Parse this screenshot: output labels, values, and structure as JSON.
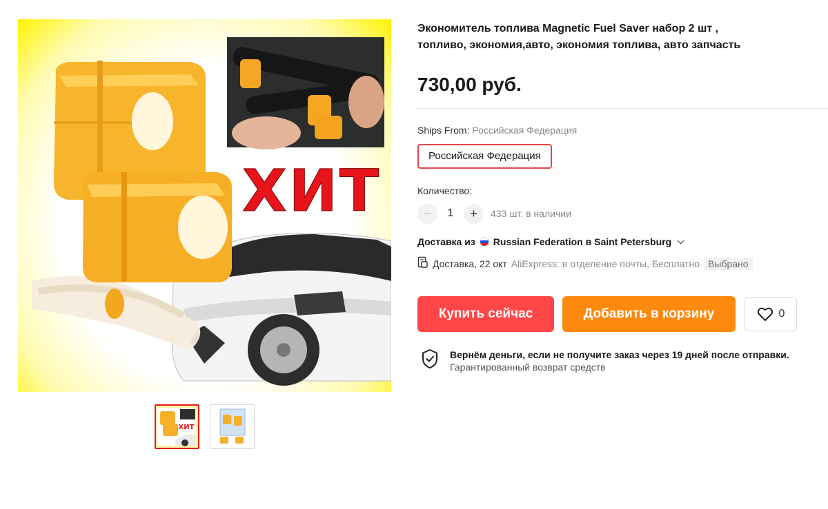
{
  "product": {
    "title": "Экономитель топлива Magnetic Fuel Saver набор 2 шт , топливо, экономия,авто, экономия топлива, авто запчасть",
    "price": "730,00 руб.",
    "image_badge_text": "ХИТ"
  },
  "gallery": {
    "thumbnails": [
      "thumb-1",
      "thumb-2"
    ],
    "selected_index": 0
  },
  "shipping": {
    "ships_from_label": "Ships From:",
    "ships_from_value": "Российская Федерация",
    "option_selected": "Российская Федерация"
  },
  "quantity": {
    "label": "Количество:",
    "minus": "−",
    "plus": "+",
    "value": "1",
    "stock": "433 шт. в наличии"
  },
  "delivery": {
    "from_label": "Доставка из",
    "from_location": "Russian Federation в Saint Petersburg",
    "date_text": "Доставка, 22 окт",
    "carrier": "AliExpress:",
    "method": "в отделение почты, Бесплатно",
    "selected_badge": "Выбрано"
  },
  "actions": {
    "buy_now": "Купить сейчас",
    "add_to_cart": "Добавить в корзину",
    "wishlist_count": "0"
  },
  "guarantee": {
    "title": "Вернём деньги, если не получите заказ через 19 дней после отправки.",
    "subtitle": "Гарантированный возврат средств"
  },
  "colors": {
    "buy_button": "#ff4747",
    "cart_button": "#fd8a0d",
    "selected_border": "#e54545"
  },
  "icons": {
    "heart": "heart-icon",
    "shield": "shield-check-icon",
    "doc": "delivery-doc-icon",
    "chevron": "chevron-down-icon",
    "flag": "russia-flag-icon"
  }
}
